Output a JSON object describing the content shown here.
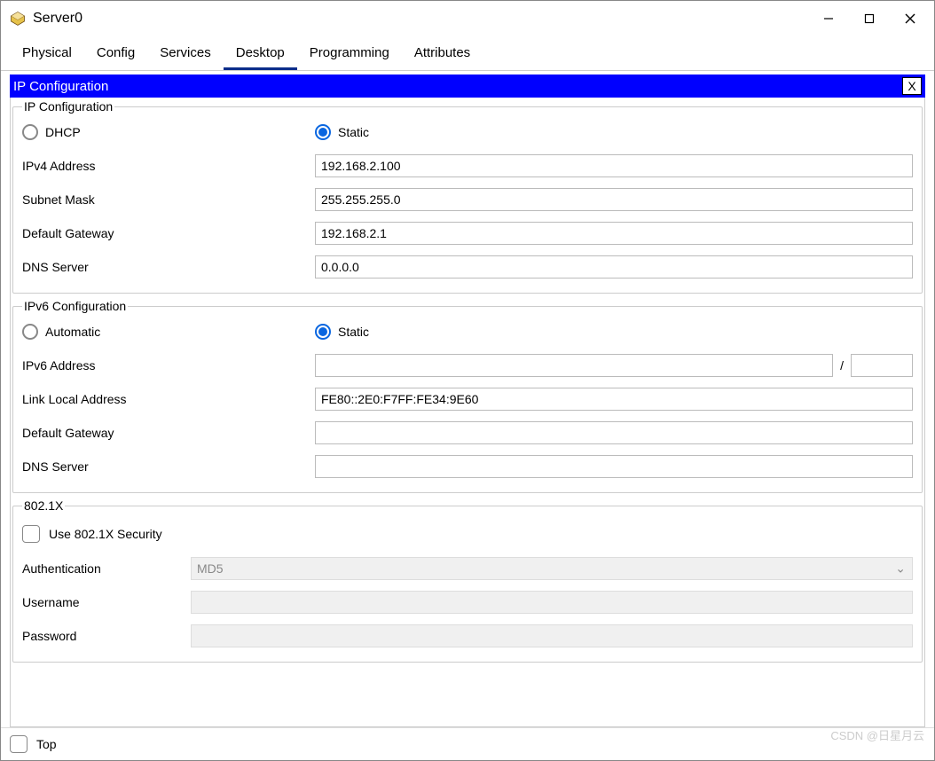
{
  "window": {
    "title": "Server0"
  },
  "tabs": [
    {
      "label": "Physical",
      "active": false
    },
    {
      "label": "Config",
      "active": false
    },
    {
      "label": "Services",
      "active": false
    },
    {
      "label": "Desktop",
      "active": true
    },
    {
      "label": "Programming",
      "active": false
    },
    {
      "label": "Attributes",
      "active": false
    }
  ],
  "panel": {
    "title": "IP Configuration",
    "close_label": "X"
  },
  "ipconfig": {
    "legend": "IP Configuration",
    "dhcp_label": "DHCP",
    "static_label": "Static",
    "mode_selected": "static",
    "ipv4_label": "IPv4 Address",
    "ipv4_value": "192.168.2.100",
    "subnet_label": "Subnet Mask",
    "subnet_value": "255.255.255.0",
    "gateway_label": "Default Gateway",
    "gateway_value": "192.168.2.1",
    "dns_label": "DNS Server",
    "dns_value": "0.0.0.0"
  },
  "ipv6config": {
    "legend": "IPv6 Configuration",
    "auto_label": "Automatic",
    "static_label": "Static",
    "mode_selected": "static",
    "addr_label": "IPv6 Address",
    "addr_value": "",
    "prefix_sep": "/",
    "prefix_value": "",
    "linklocal_label": "Link Local Address",
    "linklocal_value": "FE80::2E0:F7FF:FE34:9E60",
    "gateway_label": "Default Gateway",
    "gateway_value": "",
    "dns_label": "DNS Server",
    "dns_value": ""
  },
  "dot1x": {
    "legend": "802.1X",
    "use_label": "Use 802.1X Security",
    "use_checked": false,
    "auth_label": "Authentication",
    "auth_value": "MD5",
    "user_label": "Username",
    "user_value": "",
    "pass_label": "Password",
    "pass_value": ""
  },
  "bottom": {
    "top_label": "Top",
    "top_checked": false
  },
  "watermark": "CSDN @日星月云"
}
